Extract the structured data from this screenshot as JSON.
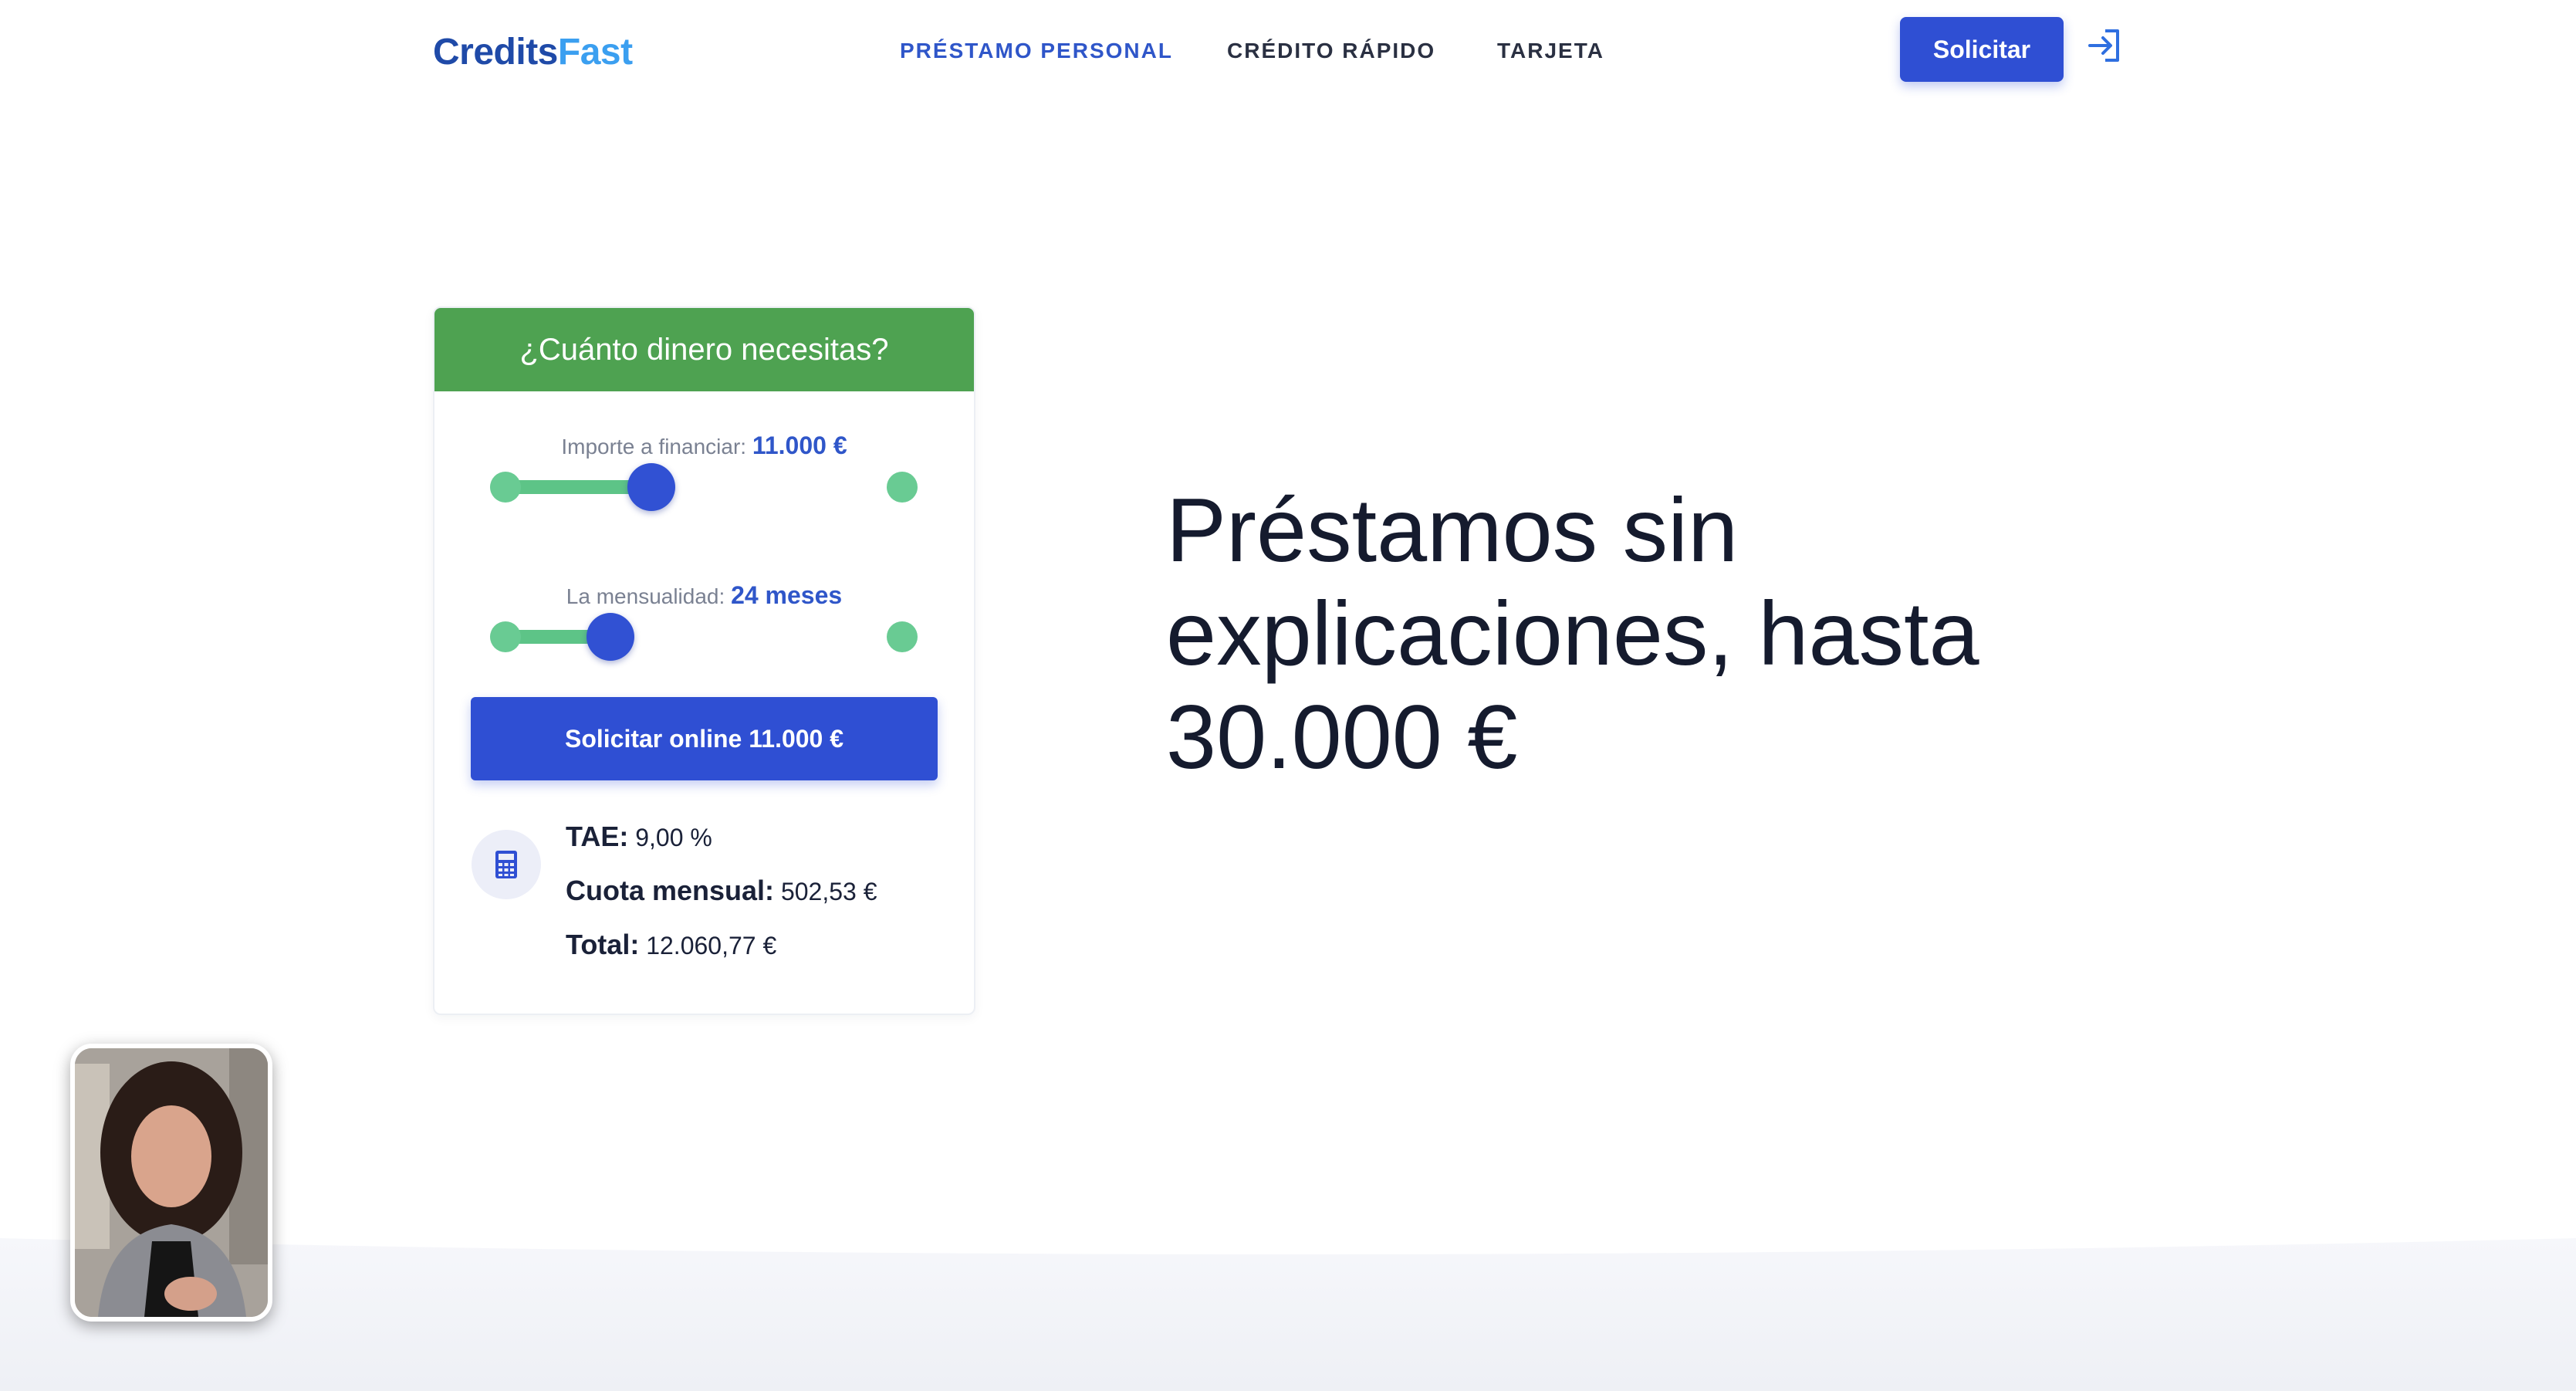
{
  "header": {
    "logo": {
      "part1": "Credits",
      "part2": "Fast"
    },
    "nav": [
      {
        "label": "PRÉSTAMO PERSONAL",
        "active": true
      },
      {
        "label": "CRÉDITO RÁPIDO",
        "active": false
      },
      {
        "label": "TARJETA",
        "active": false
      }
    ],
    "cta_label": "Solicitar",
    "login_icon": "login-icon"
  },
  "calculator": {
    "title": "¿Cuánto dinero necesitas?",
    "amount": {
      "label": "Importe a financiar:",
      "value": "11.000 €",
      "fraction": 0.36
    },
    "term": {
      "label": "La mensualidad:",
      "value": "24 meses",
      "fraction": 0.26
    },
    "submit_label": "Solicitar online 11.000 €",
    "icon": "calculator-icon",
    "stats": [
      {
        "key": "TAE:",
        "value": "9,00 %"
      },
      {
        "key": "Cuota mensual:",
        "value": "502,53 €"
      },
      {
        "key": "Total:",
        "value": "12.060,77 €"
      }
    ]
  },
  "hero": {
    "line1": "Préstamos sin",
    "line2": "explicaciones, hasta",
    "line3": "30.000 €"
  },
  "colors": {
    "primary": "#2f4fd3",
    "green_header": "#4ea251",
    "slider_green": "#5dc487",
    "text_dark": "#151b2e"
  }
}
